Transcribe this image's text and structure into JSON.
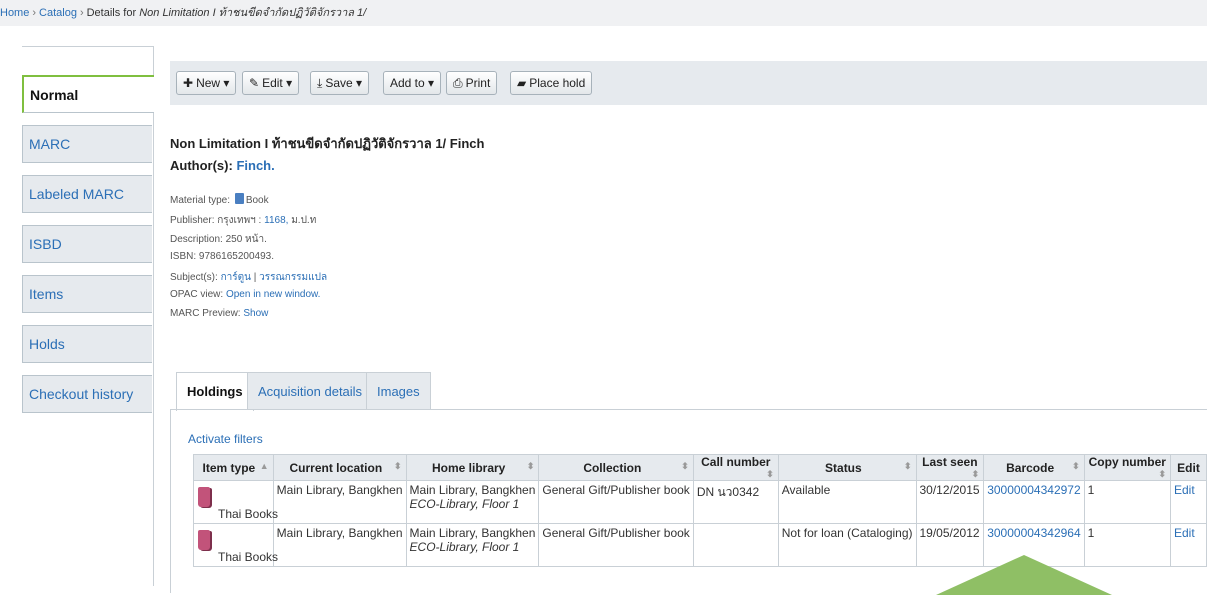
{
  "breadcrumb": {
    "home": "Home",
    "catalog": "Catalog",
    "current_prefix": "Details for",
    "current_title": "Non Limitation I ท้าชนขีดจำกัดปฏิวัติจักรวาล 1/",
    "separator": "›"
  },
  "side_tabs": [
    {
      "label": "Normal",
      "active": true
    },
    {
      "label": "MARC"
    },
    {
      "label": "Labeled MARC"
    },
    {
      "label": "ISBD"
    },
    {
      "label": "Items"
    },
    {
      "label": "Holds"
    },
    {
      "label": "Checkout history"
    }
  ],
  "toolbar": {
    "new": "New",
    "edit": "Edit",
    "save": "Save",
    "add_to": "Add to",
    "print": "Print",
    "place_hold": "Place hold"
  },
  "record": {
    "title": "Non Limitation I ท้าชนขีดจำกัดปฏิวัติจักรวาล 1/ Finch",
    "authors_label": "Author(s):",
    "author": "Finch.",
    "material_type_label": "Material type:",
    "material_type": "Book",
    "publisher_label": "Publisher:",
    "publisher_place": "กรุงเทพฯ :",
    "publisher_name": "1168,",
    "publisher_date": "ม.ป.ท",
    "description_label": "Description:",
    "description": "250 หน้า.",
    "isbn_label": "ISBN:",
    "isbn": "9786165200493.",
    "subjects_label": "Subject(s):",
    "subject_1": "การ์ตูน",
    "subject_sep": "|",
    "subject_2": "วรรณกรรมแปล",
    "opac_label": "OPAC view:",
    "opac_link": "Open in new window.",
    "marc_preview_label": "MARC Preview:",
    "marc_preview_link": "Show"
  },
  "holding_tabs": [
    "Holdings",
    "Acquisition details",
    "Images"
  ],
  "activate_filters": "Activate filters",
  "table": {
    "headers": [
      "Item type",
      "Current location",
      "Home library",
      "Collection",
      "Call number",
      "Status",
      "Last seen",
      "Barcode",
      "Copy number",
      "Edit"
    ],
    "rows": [
      {
        "item_type": "Thai Books",
        "current_location": "Main Library, Bangkhen",
        "home_library": "Main Library, Bangkhen",
        "home_library_sub": "ECO-Library, Floor 1",
        "collection": "General Gift/Publisher book",
        "call_number": "DN นว0342",
        "status": "Available",
        "last_seen": "30/12/2015",
        "barcode": "30000004342972",
        "copy_number": "1",
        "edit": "Edit"
      },
      {
        "item_type": "Thai Books",
        "current_location": "Main Library, Bangkhen",
        "home_library": "Main Library, Bangkhen",
        "home_library_sub": "ECO-Library, Floor 1",
        "collection": "General Gift/Publisher book",
        "call_number": "",
        "status": "Not for loan (Cataloging)",
        "last_seen": "19/05/2012",
        "barcode": "30000004342964",
        "copy_number": "1",
        "edit": "Edit"
      }
    ]
  },
  "colors": {
    "link": "#2b6fb6",
    "active_tab_border": "#7fbf3f",
    "arrow": "#8fbf65",
    "book_icon": "#c2537a"
  }
}
